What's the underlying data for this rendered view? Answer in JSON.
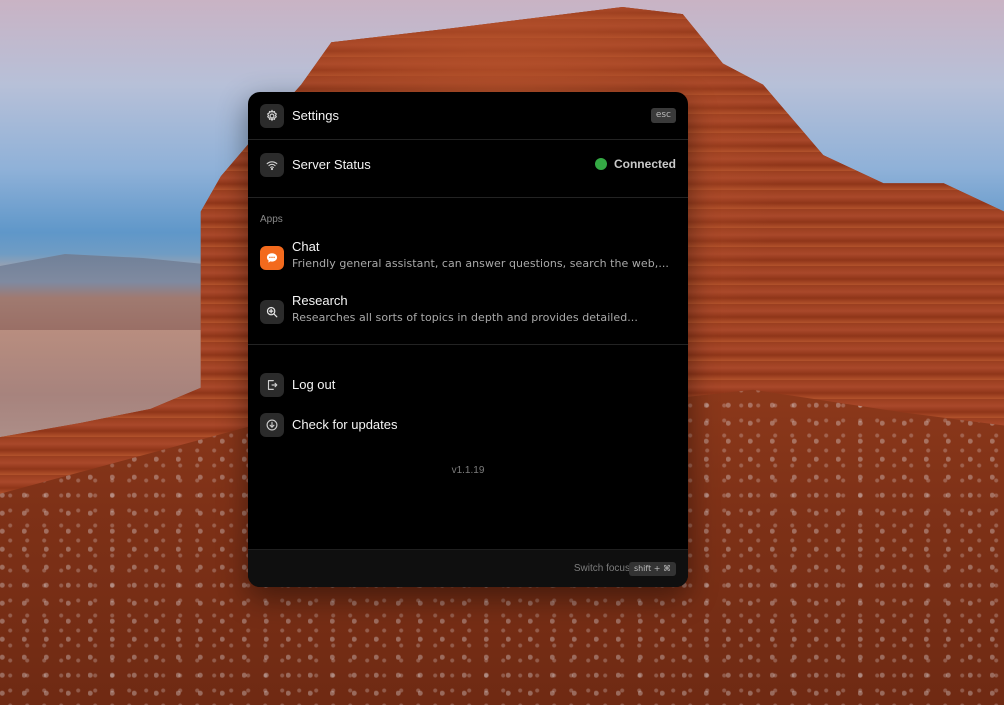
{
  "menu": {
    "settings": {
      "label": "Settings",
      "icon": "gear-icon",
      "shortcut": "esc"
    },
    "server_status": {
      "label": "Server Status",
      "icon": "wifi-icon",
      "status": "Connected",
      "status_color": "#34a944"
    },
    "apps_section_label": "Apps",
    "apps": [
      {
        "title": "Chat",
        "description": "Friendly general assistant, can answer questions, search the web,...",
        "icon": "chat-bubble-icon",
        "icon_color": "#f36a1d"
      },
      {
        "title": "Research",
        "description": "Researches all sorts of topics in depth and provides detailed...",
        "icon": "magnifier-plus-icon"
      }
    ],
    "actions": [
      {
        "label": "Log out",
        "icon": "logout-icon"
      },
      {
        "label": "Check for updates",
        "icon": "download-icon"
      }
    ],
    "version": "v1.1.19"
  },
  "footer": {
    "switch_focus_label": "Switch focus",
    "switch_focus_shortcut": "shift + ⌘"
  }
}
